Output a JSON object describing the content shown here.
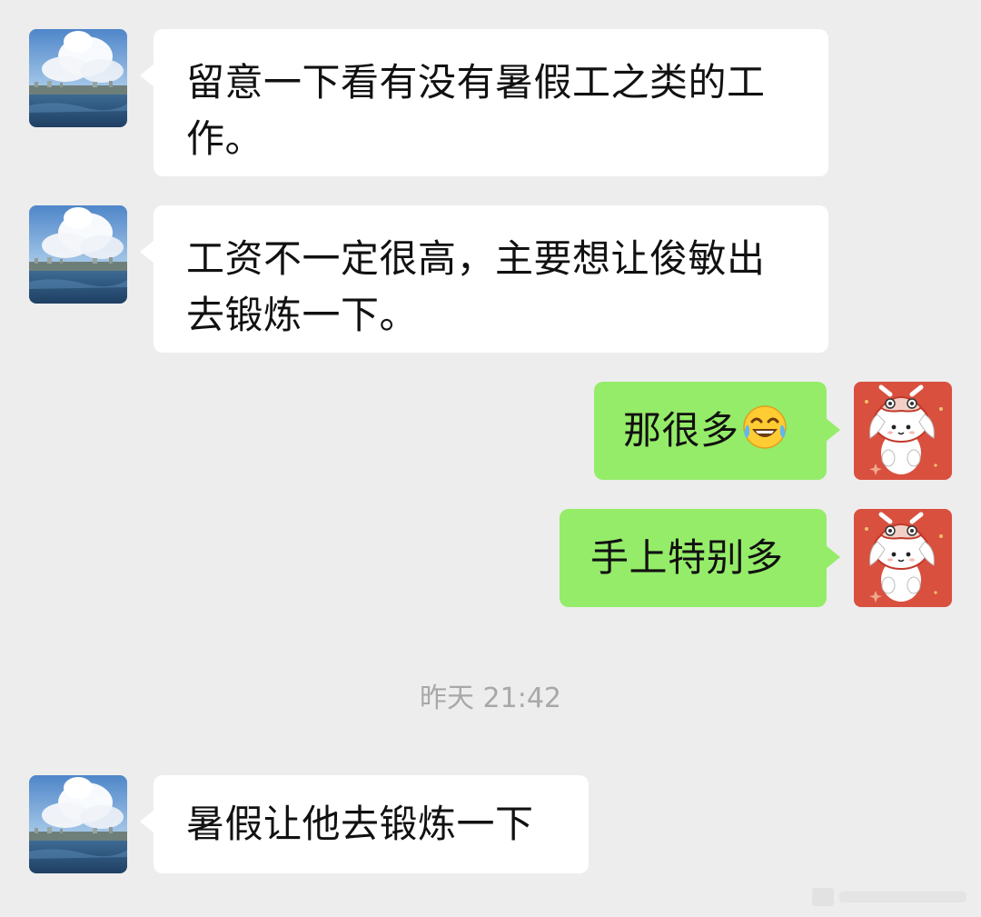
{
  "messages": [
    {
      "side": "in",
      "text": "留意一下看有没有暑假工之类的工作。"
    },
    {
      "side": "in",
      "text": "工资不一定很高，主要想让俊敏出去锻炼一下。"
    },
    {
      "side": "out",
      "text": "那很多",
      "emoji": "tears-of-joy-emoji"
    },
    {
      "side": "out",
      "text": "手上特别多"
    },
    {
      "side": "in",
      "text": "暑假让他去锻炼一下"
    }
  ],
  "timestamp": "昨天 21:42",
  "avatars": {
    "contact": "landscape-sky-avatar",
    "self": "lion-dance-bunny-avatar"
  },
  "colors": {
    "background": "#ededed",
    "incoming_bubble": "#ffffff",
    "outgoing_bubble": "#95ec69",
    "timestamp": "#a8a8a8",
    "self_avatar_bg": "#d9503f"
  }
}
